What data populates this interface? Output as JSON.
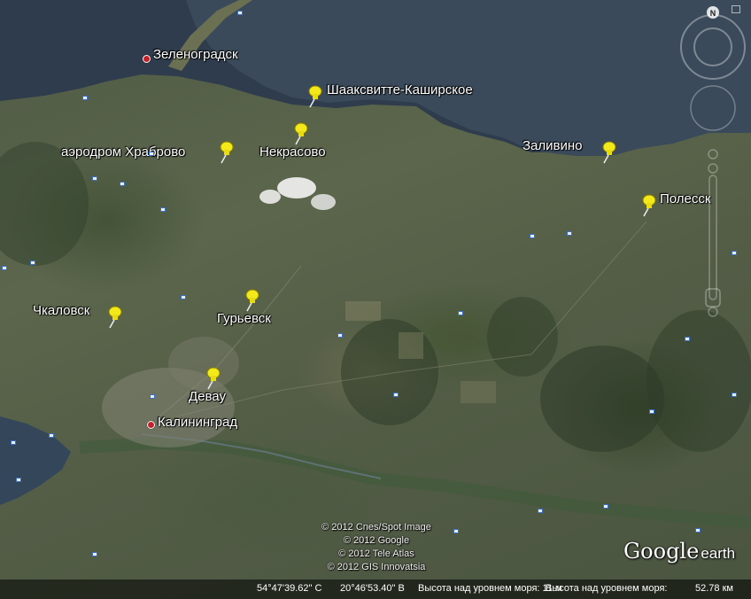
{
  "places": [
    {
      "id": "zelenogradsk",
      "label": "Зеленоградск"
    },
    {
      "id": "shaaksvitte",
      "label": "Шааксвитте-Каширское"
    },
    {
      "id": "khrabrovo",
      "label": "аэродром Храброво"
    },
    {
      "id": "nekrasovo",
      "label": "Некрасово"
    },
    {
      "id": "zalivino",
      "label": "Заливино"
    },
    {
      "id": "polessk",
      "label": "Полесск"
    },
    {
      "id": "chkalovsk",
      "label": "Чкаловск"
    },
    {
      "id": "gurievsk",
      "label": "Гурьевск"
    },
    {
      "id": "devau",
      "label": "Девау"
    },
    {
      "id": "kaliningrad",
      "label": "Калининград"
    }
  ],
  "copyright": [
    "© 2012 Cnes/Spot Image",
    "© 2012 Google",
    "© 2012 Tele Atlas",
    "© 2012 GIS Innovatsia"
  ],
  "logo": {
    "brand": "Google",
    "product": "earth"
  },
  "status": {
    "latitude": "54°47'39.62\" С",
    "longitude": "20°46'53.40\" В",
    "elevation": "Высота над уровнем моря:   11 м",
    "eye_alt_label": "Высота над уровнем моря:",
    "eye_alt_value": "52.78 км"
  },
  "compass": {
    "north": "N"
  },
  "colors": {
    "water": "#2f3d4f",
    "land": "#566147",
    "pin": "#f2e81a",
    "poi": "#3a6fc4"
  }
}
